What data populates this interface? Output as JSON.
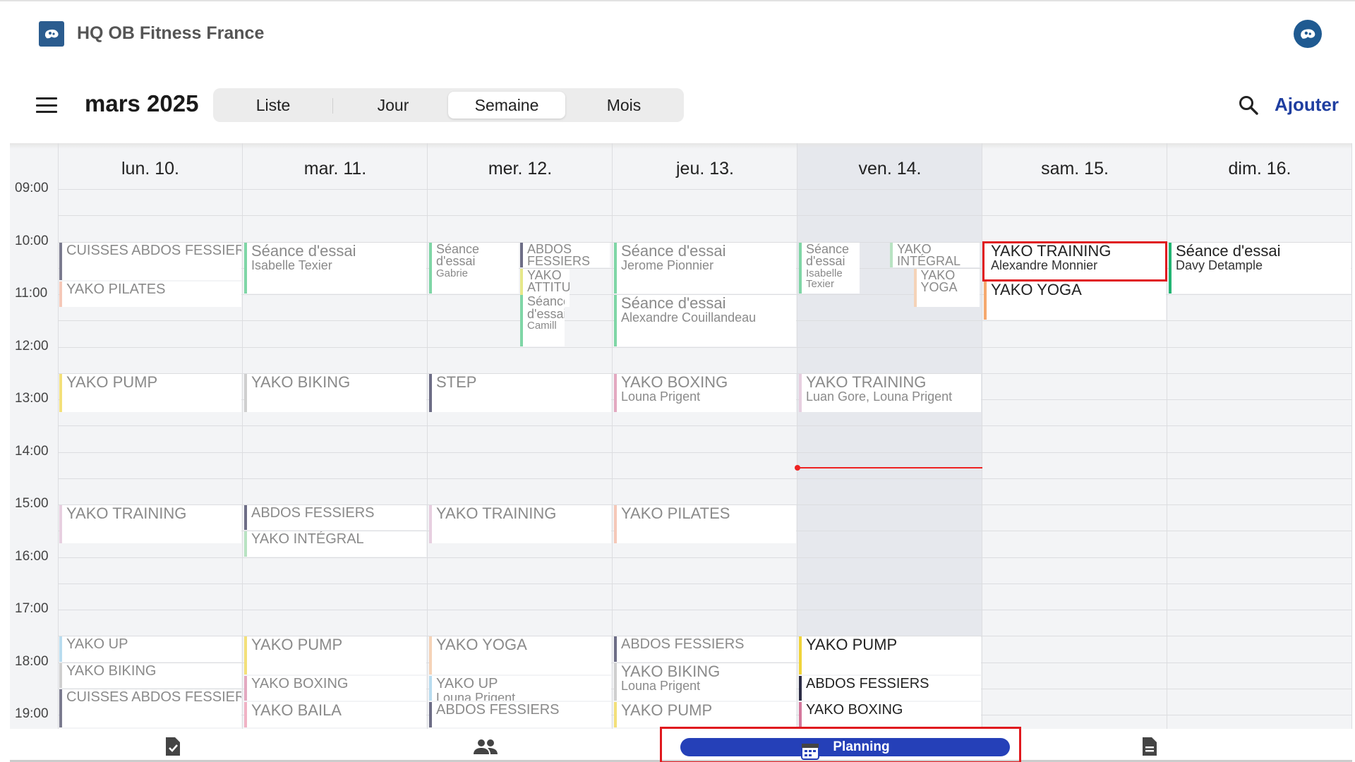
{
  "app": {
    "name": "HQ OB Fitness France"
  },
  "header": {
    "title": "mars 2025",
    "add_label": "Ajouter"
  },
  "views": [
    {
      "label": "Liste",
      "active": false
    },
    {
      "label": "Jour",
      "active": false
    },
    {
      "label": "Semaine",
      "active": true
    },
    {
      "label": "Mois",
      "active": false
    }
  ],
  "days": [
    "lun. 10.",
    "mar. 11.",
    "mer. 12.",
    "jeu. 13.",
    "ven. 14.",
    "sam. 15.",
    "dim. 16."
  ],
  "today_index": 4,
  "hours": [
    "09:00",
    "10:00",
    "11:00",
    "12:00",
    "13:00",
    "14:00",
    "15:00",
    "16:00",
    "17:00",
    "18:00",
    "19:00"
  ],
  "current_time": "14:17",
  "events": [
    {
      "day": 0,
      "start": "10:00",
      "end": "10:45",
      "title": "CUISSES ABDOS FESSIERS",
      "subtitle": "",
      "color": "#7b7b8f",
      "size": "sm"
    },
    {
      "day": 0,
      "start": "10:45",
      "end": "11:15",
      "title": "YAKO PILATES",
      "subtitle": "",
      "color": "#f5c8b8",
      "size": "sm"
    },
    {
      "day": 0,
      "start": "12:30",
      "end": "13:15",
      "title": "YAKO PUMP",
      "subtitle": "",
      "color": "#f3e07a"
    },
    {
      "day": 0,
      "start": "15:00",
      "end": "15:45",
      "title": "YAKO TRAINING",
      "subtitle": "",
      "color": "#e7cfe0"
    },
    {
      "day": 0,
      "start": "17:30",
      "end": "18:00",
      "title": "YAKO UP",
      "subtitle": "",
      "color": "#b9dcef",
      "size": "sm"
    },
    {
      "day": 0,
      "start": "18:00",
      "end": "18:30",
      "title": "YAKO BIKING",
      "subtitle": "",
      "color": "#cfcfcf",
      "size": "sm"
    },
    {
      "day": 0,
      "start": "18:30",
      "end": "19:15",
      "title": "CUISSES ABDOS FESSIERS",
      "subtitle": "",
      "color": "#7b7b8f",
      "size": "sm"
    },
    {
      "day": 1,
      "start": "10:00",
      "end": "11:00",
      "title": "Séance d'essai",
      "subtitle": "Isabelle Texier",
      "color": "#7fd6a6"
    },
    {
      "day": 1,
      "start": "12:30",
      "end": "13:15",
      "title": "YAKO BIKING",
      "subtitle": "",
      "color": "#cfcfcf"
    },
    {
      "day": 1,
      "start": "15:00",
      "end": "15:30",
      "title": "ABDOS FESSIERS",
      "subtitle": "",
      "color": "#6d6d86",
      "size": "sm"
    },
    {
      "day": 1,
      "start": "15:30",
      "end": "16:00",
      "title": "YAKO INTÉGRAL",
      "subtitle": "",
      "color": "#b8e3c2",
      "size": "sm"
    },
    {
      "day": 1,
      "start": "17:30",
      "end": "18:15",
      "title": "YAKO PUMP",
      "subtitle": "",
      "color": "#f3e07a"
    },
    {
      "day": 1,
      "start": "18:15",
      "end": "18:45",
      "title": "YAKO BOXING",
      "subtitle": "",
      "color": "#e3a9c0",
      "size": "sm"
    },
    {
      "day": 1,
      "start": "18:45",
      "end": "19:15",
      "title": "YAKO BAILA",
      "subtitle": "",
      "color": "#f0b3c5"
    },
    {
      "day": 2,
      "start": "10:00",
      "end": "11:00",
      "title": "Séance d'essai",
      "subtitle": "Gabrie",
      "color": "#7fd6a6",
      "col": 0,
      "ncol": 2,
      "narrow": true
    },
    {
      "day": 2,
      "start": "10:00",
      "end": "10:30",
      "title": "ABDOS FESSIERS",
      "subtitle": "",
      "color": "#6d6d86",
      "col": 1,
      "ncol": 2,
      "narrow": true
    },
    {
      "day": 2,
      "start": "10:30",
      "end": "11:15",
      "title": "YAKO ATTITUDE",
      "subtitle": "",
      "color": "#e6e88a",
      "col": 1,
      "ncol": 2,
      "narrow": true,
      "w": 0.28
    },
    {
      "day": 2,
      "start": "11:00",
      "end": "12:00",
      "title": "Séance d'essai",
      "subtitle": "Camill",
      "color": "#7fd6a6",
      "col": 1,
      "ncol": 2,
      "narrow": true,
      "offset": 0.5,
      "w": 0.25
    },
    {
      "day": 2,
      "start": "12:30",
      "end": "13:15",
      "title": "STEP",
      "subtitle": "",
      "color": "#6d6d86"
    },
    {
      "day": 2,
      "start": "15:00",
      "end": "15:45",
      "title": "YAKO TRAINING",
      "subtitle": "",
      "color": "#e7cfe0"
    },
    {
      "day": 2,
      "start": "17:30",
      "end": "18:15",
      "title": "YAKO YOGA",
      "subtitle": "",
      "color": "#f5d3b8"
    },
    {
      "day": 2,
      "start": "18:15",
      "end": "18:45",
      "title": "YAKO UP",
      "subtitle": "Louna Prigent",
      "color": "#b9dcef",
      "size": "sm"
    },
    {
      "day": 2,
      "start": "18:45",
      "end": "19:15",
      "title": "ABDOS FESSIERS",
      "subtitle": "",
      "color": "#6d6d86",
      "size": "sm"
    },
    {
      "day": 3,
      "start": "10:00",
      "end": "11:00",
      "title": "Séance d'essai",
      "subtitle": "Jerome Pionnier",
      "color": "#7fd6a6"
    },
    {
      "day": 3,
      "start": "11:00",
      "end": "12:00",
      "title": "Séance d'essai",
      "subtitle": "Alexandre Couillandeau",
      "color": "#7fd6a6"
    },
    {
      "day": 3,
      "start": "12:30",
      "end": "13:15",
      "title": "YAKO BOXING",
      "subtitle": "Louna Prigent",
      "color": "#e3a9c0"
    },
    {
      "day": 3,
      "start": "15:00",
      "end": "15:45",
      "title": "YAKO PILATES",
      "subtitle": "",
      "color": "#f5c8b8"
    },
    {
      "day": 3,
      "start": "17:30",
      "end": "18:00",
      "title": "ABDOS FESSIERS",
      "subtitle": "",
      "color": "#6d6d86",
      "size": "sm"
    },
    {
      "day": 3,
      "start": "18:00",
      "end": "18:45",
      "title": "YAKO BIKING",
      "subtitle": "Louna Prigent",
      "color": "#cfcfcf"
    },
    {
      "day": 3,
      "start": "18:45",
      "end": "19:15",
      "title": "YAKO PUMP",
      "subtitle": "",
      "color": "#f3e07a"
    },
    {
      "day": 4,
      "start": "10:00",
      "end": "11:00",
      "title": "Séance d'essai",
      "subtitle": "Isabelle Texier",
      "color": "#7fd6a6",
      "col": 0,
      "ncol": 2,
      "narrow": true,
      "w": 0.34
    },
    {
      "day": 4,
      "start": "10:00",
      "end": "10:30",
      "title": "YAKO INTÉGRAL",
      "subtitle": "",
      "color": "#b8e3c2",
      "col": 1,
      "ncol": 2,
      "narrow": true
    },
    {
      "day": 4,
      "start": "10:30",
      "end": "11:15",
      "title": "YAKO YOGA",
      "subtitle": "",
      "color": "#f5d3b8",
      "col": 1,
      "ncol": 2,
      "narrow": true,
      "offset": 0.63,
      "w": 0.37
    },
    {
      "day": 4,
      "start": "12:30",
      "end": "13:15",
      "title": "YAKO TRAINING",
      "subtitle": "Luan Gore, Louna Prigent",
      "color": "#e7cfe0"
    },
    {
      "day": 4,
      "start": "17:30",
      "end": "18:15",
      "title": "YAKO PUMP",
      "subtitle": "",
      "color": "#f0d43a",
      "dark": true
    },
    {
      "day": 4,
      "start": "18:15",
      "end": "18:45",
      "title": "ABDOS FESSIERS",
      "subtitle": "",
      "color": "#2c2c45",
      "dark": true,
      "size": "sm"
    },
    {
      "day": 4,
      "start": "18:45",
      "end": "19:15",
      "title": "YAKO BOXING",
      "subtitle": "",
      "color": "#d4779c",
      "dark": true,
      "size": "sm"
    },
    {
      "day": 5,
      "start": "10:00",
      "end": "10:45",
      "title": "YAKO TRAINING",
      "subtitle": "Alexandre Monnier",
      "color": "#ffffff",
      "dark": true,
      "highlight": true
    },
    {
      "day": 5,
      "start": "10:45",
      "end": "11:30",
      "title": "YAKO YOGA",
      "subtitle": "",
      "color": "#f5a86e",
      "dark": true
    },
    {
      "day": 6,
      "start": "10:00",
      "end": "11:00",
      "title": "Séance d'essai",
      "subtitle": "Davy Detample",
      "color": "#22b573",
      "dark": true
    }
  ],
  "bottom_nav": [
    {
      "icon": "task-check-icon",
      "label": "",
      "active": false
    },
    {
      "icon": "people-icon",
      "label": "",
      "active": false
    },
    {
      "icon": "calendar-icon",
      "label": "Planning",
      "active": true
    },
    {
      "icon": "document-icon",
      "label": "",
      "active": false
    }
  ]
}
